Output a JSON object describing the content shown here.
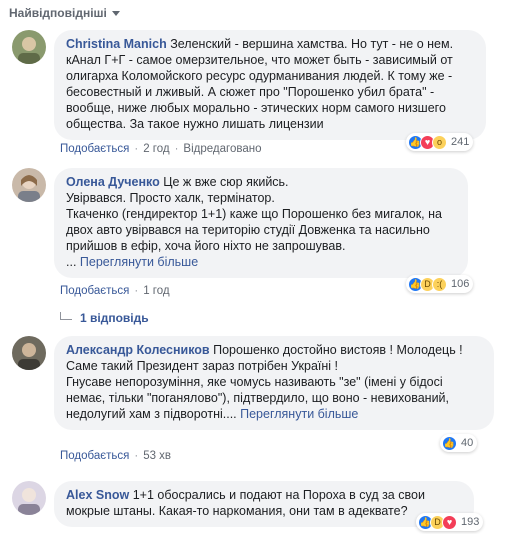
{
  "sort": {
    "label": "Найвідповідніші"
  },
  "comments": [
    {
      "author": "Christina Manich",
      "text": "Зеленский - вершина хамства. Но тут - не о нем. кАнал Г+Г - самое омерзительное, что может быть - зависимый от олигарха Коломойского ресурс одурманивания людей. К тому же - бесовестный и лживый. А сюжет про \"Порошенко убил брата\" - вообще, ниже любых морально - этических норм самого низшего общества. За такое нужно лишать лицензии",
      "like": "Подобається",
      "time": "2 год",
      "edited": "Відредаговано",
      "reactions": [
        "like",
        "love",
        "wow"
      ],
      "count": "241"
    },
    {
      "author": "Олена Дученко",
      "text": "Це ж вже сюр якийсь.\nУвірвався. Просто халк, термінатор.\nТкаченко (гендиректор 1+1) каже що Порошенко без мигалок, на двох авто увірвався на територію студії Довженка та насильно прийшов в ефір, хоча його ніхто не запрошував.\n... ",
      "more": "Переглянути більше",
      "like": "Подобається",
      "time": "1 год",
      "reactions": [
        "like",
        "haha",
        "sad"
      ],
      "count": "106"
    },
    {
      "author": "Александр Колесников",
      "text": "Порошенко достойно вистояв ! Молодець !\nСаме такий Президент зараз потрібен Україні !\nГнусаве непорозуміння, яке чомусь називають \"зе\" (імені у бідосі немає, тільки \"поганялово\"), підтвердило, що воно - невихований, недолугий хам з підворотні.... ",
      "more": "Переглянути більше",
      "like": "Подобається",
      "time": "53 хв",
      "reactions": [
        "like"
      ],
      "count": "40"
    },
    {
      "author": "Alex Snow",
      "text": "1+1 обосрались и подают на Пороха в суд за свои мокрые штаны. Какая-то наркомания, они там в адеквате?",
      "reactions": [
        "like",
        "haha",
        "love"
      ],
      "count": "193"
    }
  ],
  "replies": {
    "label": "1 відповідь"
  },
  "colors": {
    "link": "#385898",
    "bubble": "#f2f3f5",
    "meta": "#616770"
  }
}
